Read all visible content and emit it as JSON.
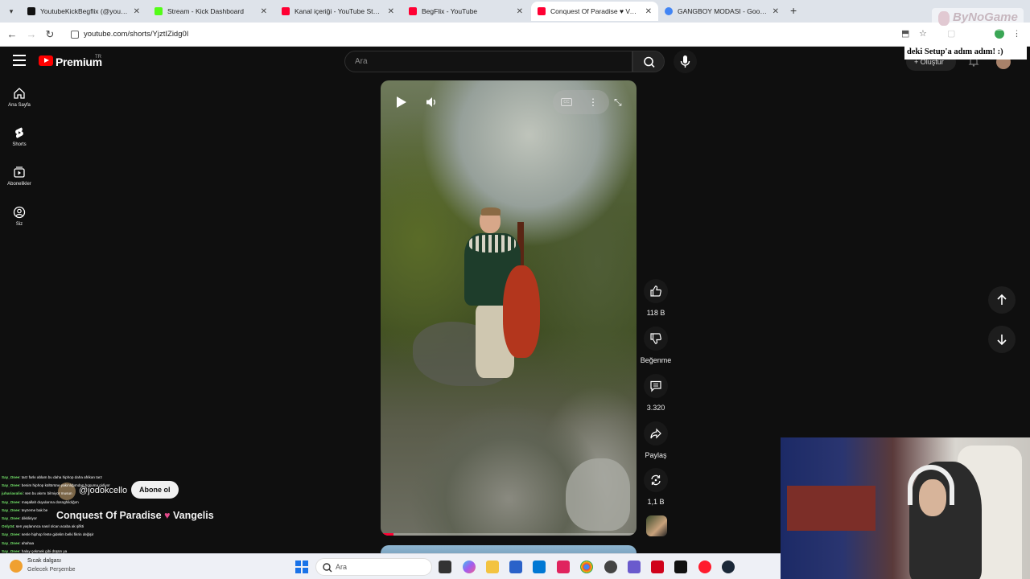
{
  "browser": {
    "tabs": [
      {
        "label": "YoutubeKickBegflix (@youtube...",
        "active": false,
        "fav_color": "#111111"
      },
      {
        "label": "Stream - Kick Dashboard",
        "active": false,
        "fav_color": "#53fc18"
      },
      {
        "label": "Kanal içeriği - YouTube Studio",
        "active": false,
        "fav_color": "#ff0033"
      },
      {
        "label": "BegFlix - YouTube",
        "active": false,
        "fav_color": "#ff0033"
      },
      {
        "label": "Conquest Of Paradise ♥ Vangel",
        "active": true,
        "fav_color": "#ff0033"
      },
      {
        "label": "GANGBOY MODASI - Google'da",
        "active": false,
        "fav_color": "#4285f4"
      }
    ],
    "url": "youtube.com/shorts/YjztIZidg0I"
  },
  "youtube": {
    "brand": "Premium",
    "country": "TR",
    "search_placeholder": "Ara",
    "create_label": "+ Oluştur",
    "sidebar": [
      {
        "label": "Ana Sayfa",
        "icon": "home-icon"
      },
      {
        "label": "Shorts",
        "icon": "shorts-icon"
      },
      {
        "label": "Abonelikler",
        "icon": "subscriptions-icon"
      },
      {
        "label": "Siz",
        "icon": "you-icon"
      }
    ],
    "actions": {
      "like_count": "118 B",
      "dislike_label": "Beğenme",
      "comment_count": "3.320",
      "share_label": "Paylaş",
      "remix_count": "1,1 B"
    },
    "video": {
      "channel": "@jodokcello",
      "subscribe_label": "Abone ol",
      "title_part1": "Conquest Of Paradise",
      "title_heart": "♥",
      "title_part2": "Vangelis",
      "progress": 0.05
    }
  },
  "chat": [
    {
      "user": "Say_Onee",
      "msg": ": tarz farkı ablam bu daha hiphop daha afrikan tarz"
    },
    {
      "user": "Say_Onee",
      "msg": ": benim hiphop kültürüne yakınlığımdan hoşuma gidiyor"
    },
    {
      "user": "juhariavalisi",
      "msg": ": sen bu akımı bilmiyor musun"
    },
    {
      "user": "Say_Onee",
      "msg": ": maşallah duyularına dosnghildığım"
    },
    {
      "user": "Say_Onee",
      "msg": ": teyzeme bak be"
    },
    {
      "user": "Say_Onee",
      "msg": ": dikkliriyor"
    },
    {
      "user": "Only34",
      "msg": ": sen yaşlanınca nasıl olcan acaba ak şifkti"
    },
    {
      "user": "Say_Onee",
      "msg": ": senle hiphop feste gidelim belki fikrin değişir"
    },
    {
      "user": "Say_Onee",
      "msg": ": ahahaa"
    },
    {
      "user": "Say_Onee",
      "msg": ": halay çekmek gibi düşün ya"
    }
  ],
  "overlay": {
    "sponsor": "ByNoGame",
    "banner": "deki Setup'a adım adım! :)"
  },
  "taskbar": {
    "weather_line1": "Sıcak dalgası",
    "weather_line2": "Gelecek Perşembe",
    "search_label": "Ara"
  },
  "colors": {
    "yt_red": "#ff0000",
    "chat_user": "#74e46a",
    "heart": "#e64b8c"
  }
}
